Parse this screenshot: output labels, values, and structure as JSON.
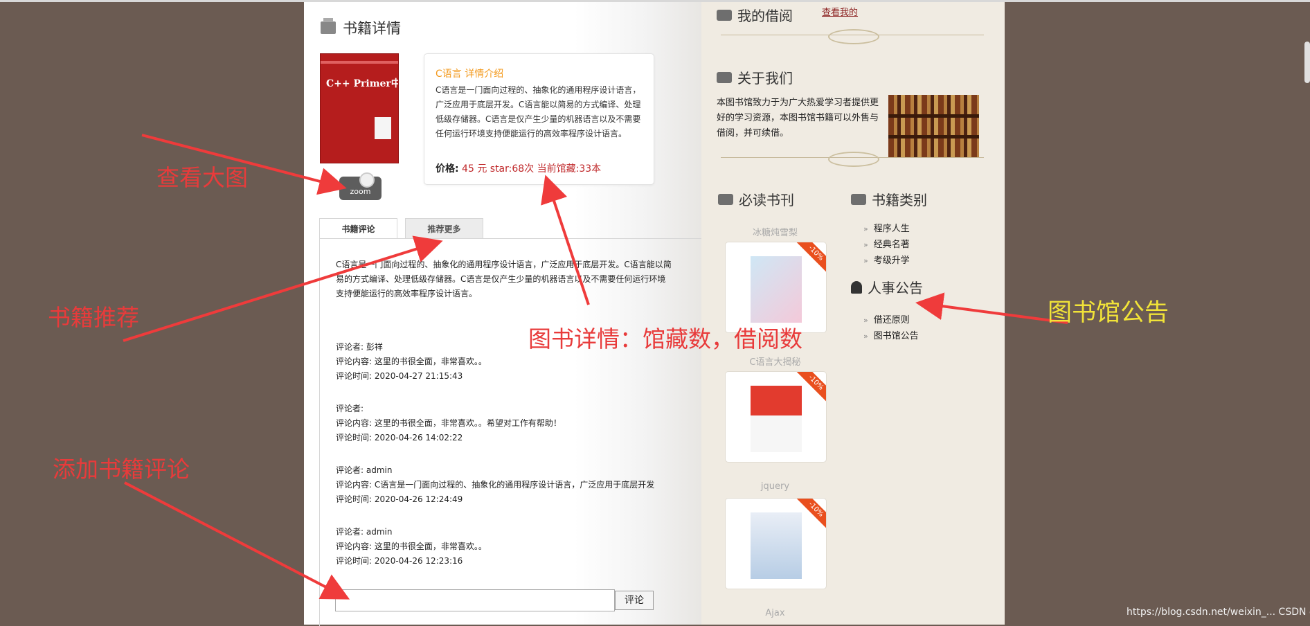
{
  "main": {
    "section_title": "书籍详情",
    "cover_title": "C++ Primer中文版",
    "zoom_label": "zoom",
    "info": {
      "heading": "C语言   详情介绍",
      "description": "C语言是一门面向过程的、抽象化的通用程序设计语言，广泛应用于底层开发。C语言能以简易的方式编译、处理低级存储器。C语言是仅产生少量的机器语言以及不需要任何运行环境支持便能运行的高效率程序设计语言。",
      "price_label": "价格:",
      "price_value": " 45 元 star:68次  当前馆藏:33本"
    },
    "tabs": [
      {
        "label": "书籍评论"
      },
      {
        "label": "推荐更多"
      }
    ],
    "intro_text": "C语言是一门面向过程的、抽象化的通用程序设计语言，广泛应用于底层开发。C语言能以简易的方式编译、处理低级存储器。C语言是仅产生少量的机器语言以及不需要任何运行环境支持便能运行的高效率程序设计语言。",
    "comments": [
      {
        "author": "评论者: 彭祥",
        "content": "评论内容: 这里的书很全面，非常喜欢。。",
        "time": "评论时间: 2020-04-27 21:15:43"
      },
      {
        "author": "评论者:",
        "content": "评论内容: 这里的书很全面，非常喜欢。。希望对工作有帮助！",
        "time": "评论时间: 2020-04-26 14:02:22"
      },
      {
        "author": "评论者: admin",
        "content": "评论内容: C语言是一门面向过程的、抽象化的通用程序设计语言，广泛应用于底层开发",
        "time": "评论时间: 2020-04-26 12:24:49"
      },
      {
        "author": "评论者: admin",
        "content": "评论内容: 这里的书很全面，非常喜欢。。",
        "time": "评论时间: 2020-04-26 12:23:16"
      }
    ],
    "comment_input_value": "",
    "comment_button": "评论"
  },
  "sidebar": {
    "borrow_title": "我的借阅",
    "borrow_link": "查看我的",
    "about_title": "关于我们",
    "about_text": "本图书馆致力于为广大热爱学习者提供更好的学习资源，本图书馆书籍可以外售与借阅，并可续借。",
    "must_read_title": "必读书刊",
    "categories_title": "书籍类别",
    "books": [
      {
        "name": "冰糖炖雪梨",
        "discount": "-10%"
      },
      {
        "name": "C语言大揭秘",
        "discount": "-10%"
      },
      {
        "name": "jquery",
        "discount": "-10%"
      },
      {
        "name": "Ajax",
        "discount": "-10%"
      }
    ],
    "categories": [
      "程序人生",
      "经典名著",
      "考级升学"
    ],
    "notice_title": "人事公告",
    "notices": [
      "借还原则",
      "图书馆公告"
    ]
  },
  "annotations": {
    "zoom": "查看大图",
    "recommend": "书籍推荐",
    "detail": "图书详情：馆藏数，借阅数",
    "comment": "添加书籍评论",
    "notice": "图书馆公告"
  },
  "watermark": "https://blog.csdn.net/weixin_... CSDN @彭祥."
}
